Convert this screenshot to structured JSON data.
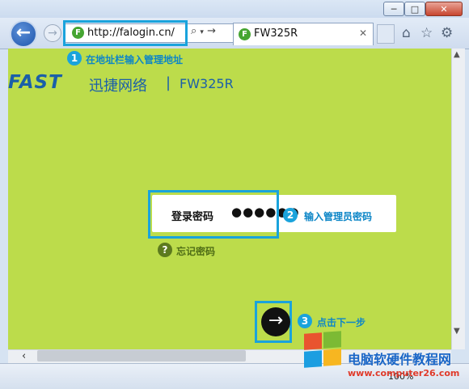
{
  "browser": {
    "url": "http://falogin.cn/",
    "tab_title": "FW325R",
    "zoom": "100%",
    "window_buttons": [
      "─",
      "□",
      "✕"
    ],
    "nav_back_icon": "back-arrow-icon",
    "nav_forward_icon": "forward-arrow-icon",
    "toolbar_icons": [
      "home-icon",
      "star-icon",
      "gear-icon"
    ]
  },
  "page": {
    "brand_logo": "FAST",
    "brand_cn": "迅捷网络",
    "separator": "|",
    "model": "FW325R",
    "login": {
      "label": "登录密码",
      "password_mask": "●●●●●●",
      "forgot_label": "忘记密码",
      "next_icon": "→"
    },
    "background_color": "#bcdc4b"
  },
  "steps": [
    {
      "number": "1",
      "text": "在地址栏输入管理地址"
    },
    {
      "number": "2",
      "text": "输入管理员密码"
    },
    {
      "number": "3",
      "text": "点击下一步"
    }
  ],
  "watermark": {
    "title": "电脑软硬件教程网",
    "url": "www.computer26.com"
  },
  "colors": {
    "accent": "#1aa3dc",
    "brand": "#1b5fa8",
    "page_bg": "#bcdc4b"
  }
}
